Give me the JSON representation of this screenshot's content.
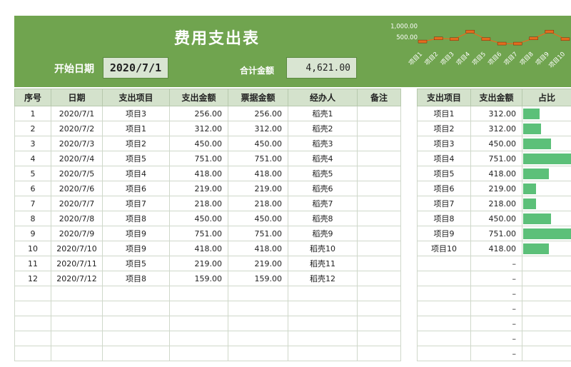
{
  "header": {
    "title": "费用支出表",
    "start_date_label": "开始日期",
    "start_date_value": "2020/7/1",
    "total_label": "合计金额",
    "total_value": "4,621.00"
  },
  "chart_data": {
    "type": "line",
    "categories": [
      "项目1",
      "项目2",
      "项目3",
      "项目4",
      "项目5",
      "项目6",
      "项目7",
      "项目8",
      "项目9",
      "项目10"
    ],
    "values": [
      312,
      450,
      418,
      751,
      418,
      219,
      218,
      450,
      751,
      418
    ],
    "yticks": [
      "1,000.00",
      "500.00"
    ],
    "ylim": [
      0,
      1200
    ],
    "line_color": "#e36c1e"
  },
  "main_table": {
    "columns": [
      "序号",
      "日期",
      "支出项目",
      "支出金额",
      "票据金额",
      "经办人",
      "备注"
    ],
    "rows": [
      [
        "1",
        "2020/7/1",
        "项目3",
        "256.00",
        "256.00",
        "稻壳1",
        ""
      ],
      [
        "2",
        "2020/7/2",
        "项目1",
        "312.00",
        "312.00",
        "稻壳2",
        ""
      ],
      [
        "3",
        "2020/7/3",
        "项目2",
        "450.00",
        "450.00",
        "稻壳3",
        ""
      ],
      [
        "4",
        "2020/7/4",
        "项目5",
        "751.00",
        "751.00",
        "稻壳4",
        ""
      ],
      [
        "5",
        "2020/7/5",
        "项目4",
        "418.00",
        "418.00",
        "稻壳5",
        ""
      ],
      [
        "6",
        "2020/7/6",
        "项目6",
        "219.00",
        "219.00",
        "稻壳6",
        ""
      ],
      [
        "7",
        "2020/7/7",
        "项目7",
        "218.00",
        "218.00",
        "稻壳7",
        ""
      ],
      [
        "8",
        "2020/7/8",
        "项目8",
        "450.00",
        "450.00",
        "稻壳8",
        ""
      ],
      [
        "9",
        "2020/7/9",
        "项目9",
        "751.00",
        "751.00",
        "稻壳9",
        ""
      ],
      [
        "10",
        "2020/7/10",
        "项目9",
        "418.00",
        "418.00",
        "稻壳10",
        ""
      ],
      [
        "11",
        "2020/7/11",
        "项目5",
        "219.00",
        "219.00",
        "稻壳11",
        ""
      ],
      [
        "12",
        "2020/7/12",
        "项目8",
        "159.00",
        "159.00",
        "稻壳12",
        ""
      ],
      [
        "",
        "",
        "",
        "",
        "",
        "",
        ""
      ],
      [
        "",
        "",
        "",
        "",
        "",
        "",
        ""
      ],
      [
        "",
        "",
        "",
        "",
        "",
        "",
        ""
      ],
      [
        "",
        "",
        "",
        "",
        "",
        "",
        ""
      ],
      [
        "",
        "",
        "",
        "",
        "",
        "",
        ""
      ]
    ]
  },
  "side_table": {
    "columns": [
      "支出项目",
      "支出金额",
      "占比"
    ],
    "rows": [
      {
        "item": "项目1",
        "amount": "312.00",
        "ratio": 0.34
      },
      {
        "item": "项目2",
        "amount": "312.00",
        "ratio": 0.37
      },
      {
        "item": "项目3",
        "amount": "450.00",
        "ratio": 0.58
      },
      {
        "item": "项目4",
        "amount": "751.00",
        "ratio": 1.0
      },
      {
        "item": "项目5",
        "amount": "418.00",
        "ratio": 0.53
      },
      {
        "item": "项目6",
        "amount": "219.00",
        "ratio": 0.27
      },
      {
        "item": "项目7",
        "amount": "218.00",
        "ratio": 0.27
      },
      {
        "item": "项目8",
        "amount": "450.00",
        "ratio": 0.58
      },
      {
        "item": "项目9",
        "amount": "751.00",
        "ratio": 1.0
      },
      {
        "item": "项目10",
        "amount": "418.00",
        "ratio": 0.53
      },
      {
        "item": "",
        "amount": "–",
        "ratio": 0
      },
      {
        "item": "",
        "amount": "–",
        "ratio": 0
      },
      {
        "item": "",
        "amount": "–",
        "ratio": 0
      },
      {
        "item": "",
        "amount": "–",
        "ratio": 0
      },
      {
        "item": "",
        "amount": "–",
        "ratio": 0
      },
      {
        "item": "",
        "amount": "–",
        "ratio": 0
      },
      {
        "item": "",
        "amount": "–",
        "ratio": 0
      }
    ]
  }
}
